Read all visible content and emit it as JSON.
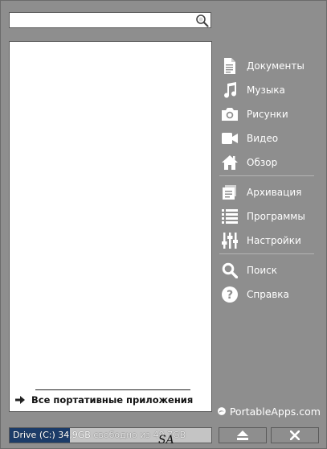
{
  "search": {
    "value": "",
    "placeholder": "",
    "icon": "search-icon"
  },
  "all_apps": {
    "label": "Все портативные приложения",
    "icon": "right-arrow-icon"
  },
  "menu": {
    "group1": [
      {
        "label": "Документы",
        "icon": "document-icon"
      },
      {
        "label": "Музыка",
        "icon": "music-note-icon"
      },
      {
        "label": "Рисунки",
        "icon": "camera-icon"
      },
      {
        "label": "Видео",
        "icon": "video-camera-icon"
      },
      {
        "label": "Обзор",
        "icon": "home-icon"
      }
    ],
    "group2": [
      {
        "label": "Архивация",
        "icon": "backup-icon"
      },
      {
        "label": "Программы",
        "icon": "list-icon"
      },
      {
        "label": "Настройки",
        "icon": "sliders-icon"
      }
    ],
    "group3": [
      {
        "label": "Поиск",
        "icon": "magnifier-icon"
      },
      {
        "label": "Справка",
        "icon": "help-icon"
      }
    ]
  },
  "logo": {
    "text": "PortableApps.com"
  },
  "drive": {
    "label": "Drive (C:) 34,9GB",
    "rest": " свободно из 49,7GB",
    "used_fraction": 0.3
  },
  "signature": "SA",
  "controls": {
    "eject_icon": "eject-icon",
    "close_icon": "close-icon"
  },
  "colors": {
    "background": "#8e8e8e",
    "drive_fill": "#1c3c69",
    "menu_text": "#ffffff"
  }
}
